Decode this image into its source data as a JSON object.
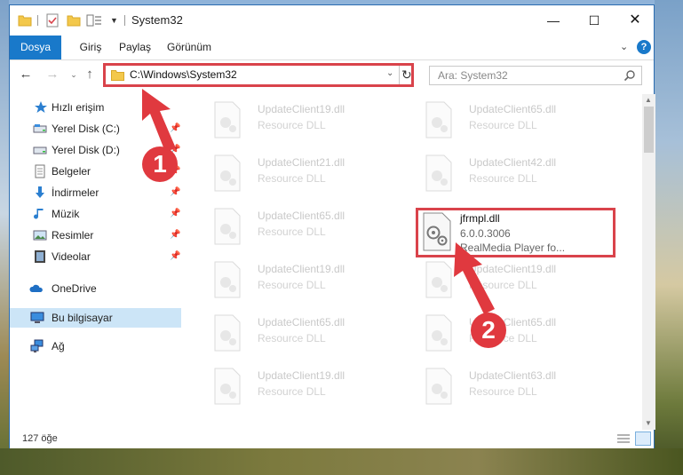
{
  "window": {
    "title": "System32"
  },
  "ribbon": {
    "tabs": [
      "Dosya",
      "Giriş",
      "Paylaş",
      "Görünüm"
    ]
  },
  "nav": {
    "address": "C:\\Windows\\System32",
    "search_placeholder": "Ara: System32"
  },
  "sidebar": {
    "items": [
      {
        "label": "Hızlı erişim",
        "icon": "star-icon"
      },
      {
        "label": "Yerel Disk (C:)",
        "icon": "drive-icon",
        "pinned": true
      },
      {
        "label": "Yerel Disk (D:)",
        "icon": "drive-icon",
        "pinned": true
      },
      {
        "label": "Belgeler",
        "icon": "documents-icon",
        "pinned": true
      },
      {
        "label": "İndirmeler",
        "icon": "downloads-icon",
        "pinned": true
      },
      {
        "label": "Müzik",
        "icon": "music-icon",
        "pinned": true
      },
      {
        "label": "Resimler",
        "icon": "pictures-icon",
        "pinned": true
      },
      {
        "label": "Videolar",
        "icon": "videos-icon",
        "pinned": true
      },
      {
        "label": "OneDrive",
        "icon": "onedrive-icon"
      },
      {
        "label": "Bu bilgisayar",
        "icon": "this-pc-icon",
        "selected": true
      },
      {
        "label": "Ağ",
        "icon": "network-icon"
      }
    ]
  },
  "files": {
    "left_column": [
      {
        "name": "UpdateClient19.dll",
        "desc": "Resource DLL"
      },
      {
        "name": "UpdateClient21.dll",
        "desc": "Resource DLL"
      },
      {
        "name": "UpdateClient65.dll",
        "desc": "Resource DLL"
      },
      {
        "name": "UpdateClient19.dll",
        "desc": "Resource DLL"
      },
      {
        "name": "UpdateClient65.dll",
        "desc": "Resource DLL"
      },
      {
        "name": "UpdateClient19.dll",
        "desc": "Resource DLL"
      }
    ],
    "right_column": [
      {
        "name": "UpdateClient65.dll",
        "desc": "Resource DLL"
      },
      {
        "name": "UpdateClient42.dll",
        "desc": "Resource DLL"
      },
      {
        "name": "UpdateClient19.dll",
        "desc": "Resource DLL"
      },
      {
        "name": "UpdateClient65.dll",
        "desc": "Resource DLL"
      },
      {
        "name": "UpdateClient63.dll",
        "desc": "Resource DLL"
      }
    ],
    "highlighted": {
      "name": "jfrmpl.dll",
      "version": "6.0.0.3006",
      "desc": "RealMedia Player fo..."
    }
  },
  "status": {
    "item_count": "127 öğe"
  },
  "callouts": [
    "1",
    "2"
  ],
  "colors": {
    "accent": "#1979ca",
    "annotation": "#d9434b",
    "selection": "#cce5f7"
  }
}
